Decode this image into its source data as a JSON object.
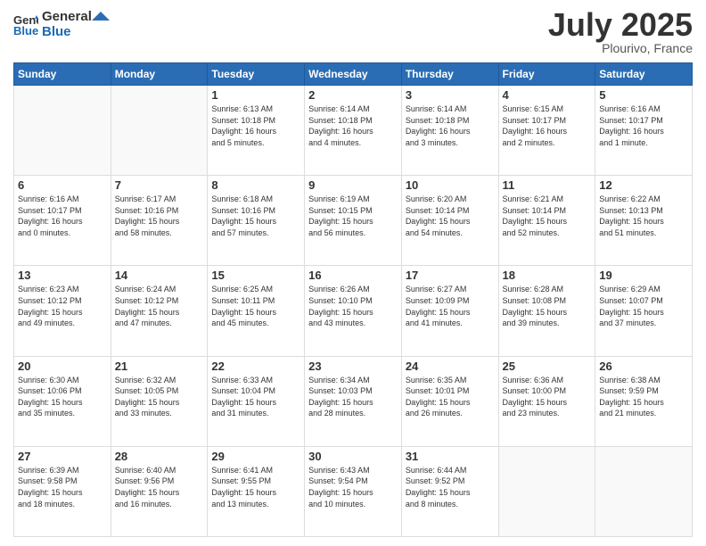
{
  "header": {
    "logo_line1": "General",
    "logo_line2": "Blue",
    "month": "July 2025",
    "location": "Plourivo, France"
  },
  "days_of_week": [
    "Sunday",
    "Monday",
    "Tuesday",
    "Wednesday",
    "Thursday",
    "Friday",
    "Saturday"
  ],
  "weeks": [
    [
      {
        "day": "",
        "info": ""
      },
      {
        "day": "",
        "info": ""
      },
      {
        "day": "1",
        "info": "Sunrise: 6:13 AM\nSunset: 10:18 PM\nDaylight: 16 hours\nand 5 minutes."
      },
      {
        "day": "2",
        "info": "Sunrise: 6:14 AM\nSunset: 10:18 PM\nDaylight: 16 hours\nand 4 minutes."
      },
      {
        "day": "3",
        "info": "Sunrise: 6:14 AM\nSunset: 10:18 PM\nDaylight: 16 hours\nand 3 minutes."
      },
      {
        "day": "4",
        "info": "Sunrise: 6:15 AM\nSunset: 10:17 PM\nDaylight: 16 hours\nand 2 minutes."
      },
      {
        "day": "5",
        "info": "Sunrise: 6:16 AM\nSunset: 10:17 PM\nDaylight: 16 hours\nand 1 minute."
      }
    ],
    [
      {
        "day": "6",
        "info": "Sunrise: 6:16 AM\nSunset: 10:17 PM\nDaylight: 16 hours\nand 0 minutes."
      },
      {
        "day": "7",
        "info": "Sunrise: 6:17 AM\nSunset: 10:16 PM\nDaylight: 15 hours\nand 58 minutes."
      },
      {
        "day": "8",
        "info": "Sunrise: 6:18 AM\nSunset: 10:16 PM\nDaylight: 15 hours\nand 57 minutes."
      },
      {
        "day": "9",
        "info": "Sunrise: 6:19 AM\nSunset: 10:15 PM\nDaylight: 15 hours\nand 56 minutes."
      },
      {
        "day": "10",
        "info": "Sunrise: 6:20 AM\nSunset: 10:14 PM\nDaylight: 15 hours\nand 54 minutes."
      },
      {
        "day": "11",
        "info": "Sunrise: 6:21 AM\nSunset: 10:14 PM\nDaylight: 15 hours\nand 52 minutes."
      },
      {
        "day": "12",
        "info": "Sunrise: 6:22 AM\nSunset: 10:13 PM\nDaylight: 15 hours\nand 51 minutes."
      }
    ],
    [
      {
        "day": "13",
        "info": "Sunrise: 6:23 AM\nSunset: 10:12 PM\nDaylight: 15 hours\nand 49 minutes."
      },
      {
        "day": "14",
        "info": "Sunrise: 6:24 AM\nSunset: 10:12 PM\nDaylight: 15 hours\nand 47 minutes."
      },
      {
        "day": "15",
        "info": "Sunrise: 6:25 AM\nSunset: 10:11 PM\nDaylight: 15 hours\nand 45 minutes."
      },
      {
        "day": "16",
        "info": "Sunrise: 6:26 AM\nSunset: 10:10 PM\nDaylight: 15 hours\nand 43 minutes."
      },
      {
        "day": "17",
        "info": "Sunrise: 6:27 AM\nSunset: 10:09 PM\nDaylight: 15 hours\nand 41 minutes."
      },
      {
        "day": "18",
        "info": "Sunrise: 6:28 AM\nSunset: 10:08 PM\nDaylight: 15 hours\nand 39 minutes."
      },
      {
        "day": "19",
        "info": "Sunrise: 6:29 AM\nSunset: 10:07 PM\nDaylight: 15 hours\nand 37 minutes."
      }
    ],
    [
      {
        "day": "20",
        "info": "Sunrise: 6:30 AM\nSunset: 10:06 PM\nDaylight: 15 hours\nand 35 minutes."
      },
      {
        "day": "21",
        "info": "Sunrise: 6:32 AM\nSunset: 10:05 PM\nDaylight: 15 hours\nand 33 minutes."
      },
      {
        "day": "22",
        "info": "Sunrise: 6:33 AM\nSunset: 10:04 PM\nDaylight: 15 hours\nand 31 minutes."
      },
      {
        "day": "23",
        "info": "Sunrise: 6:34 AM\nSunset: 10:03 PM\nDaylight: 15 hours\nand 28 minutes."
      },
      {
        "day": "24",
        "info": "Sunrise: 6:35 AM\nSunset: 10:01 PM\nDaylight: 15 hours\nand 26 minutes."
      },
      {
        "day": "25",
        "info": "Sunrise: 6:36 AM\nSunset: 10:00 PM\nDaylight: 15 hours\nand 23 minutes."
      },
      {
        "day": "26",
        "info": "Sunrise: 6:38 AM\nSunset: 9:59 PM\nDaylight: 15 hours\nand 21 minutes."
      }
    ],
    [
      {
        "day": "27",
        "info": "Sunrise: 6:39 AM\nSunset: 9:58 PM\nDaylight: 15 hours\nand 18 minutes."
      },
      {
        "day": "28",
        "info": "Sunrise: 6:40 AM\nSunset: 9:56 PM\nDaylight: 15 hours\nand 16 minutes."
      },
      {
        "day": "29",
        "info": "Sunrise: 6:41 AM\nSunset: 9:55 PM\nDaylight: 15 hours\nand 13 minutes."
      },
      {
        "day": "30",
        "info": "Sunrise: 6:43 AM\nSunset: 9:54 PM\nDaylight: 15 hours\nand 10 minutes."
      },
      {
        "day": "31",
        "info": "Sunrise: 6:44 AM\nSunset: 9:52 PM\nDaylight: 15 hours\nand 8 minutes."
      },
      {
        "day": "",
        "info": ""
      },
      {
        "day": "",
        "info": ""
      }
    ]
  ]
}
